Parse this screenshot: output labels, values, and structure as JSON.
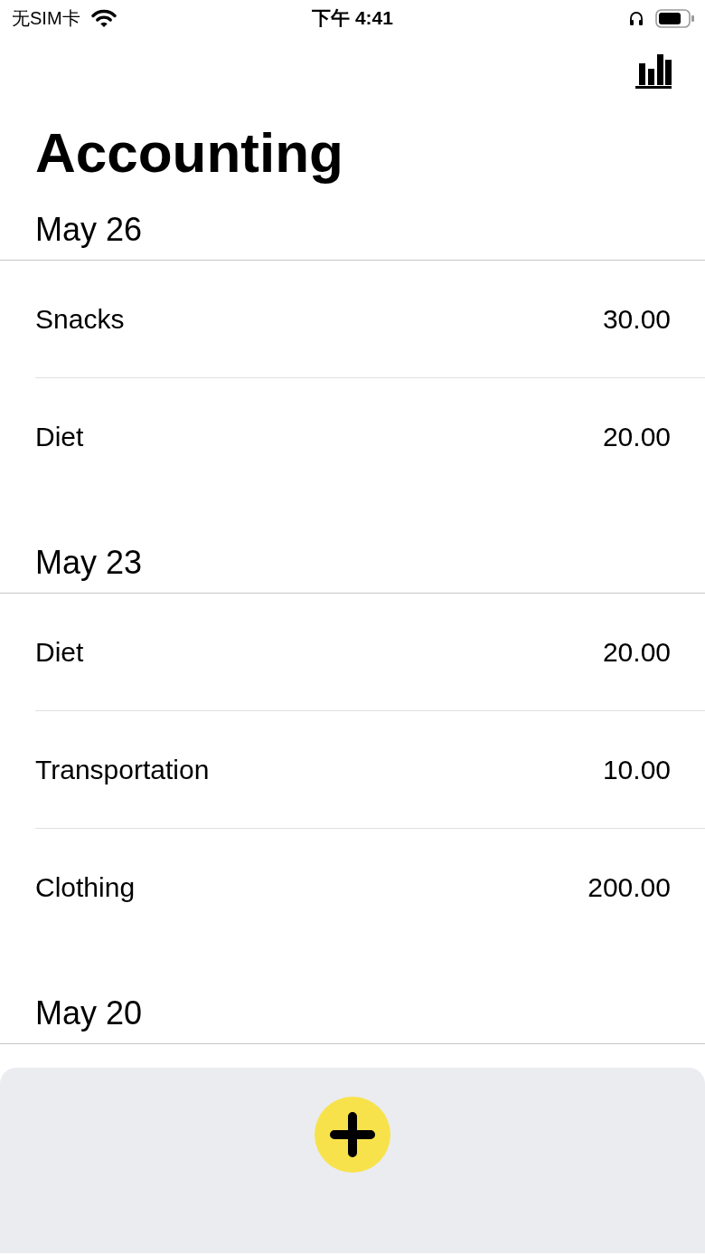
{
  "status_bar": {
    "carrier": "无SIM卡",
    "time": "下午 4:41"
  },
  "title": "Accounting",
  "sections": [
    {
      "date": "May 26",
      "entries": [
        {
          "category": "Snacks",
          "amount": "30.00"
        },
        {
          "category": "Diet",
          "amount": "20.00"
        }
      ]
    },
    {
      "date": "May 23",
      "entries": [
        {
          "category": "Diet",
          "amount": "20.00"
        },
        {
          "category": "Transportation",
          "amount": "10.00"
        },
        {
          "category": "Clothing",
          "amount": "200.00"
        }
      ]
    },
    {
      "date": "May 20"
    }
  ]
}
